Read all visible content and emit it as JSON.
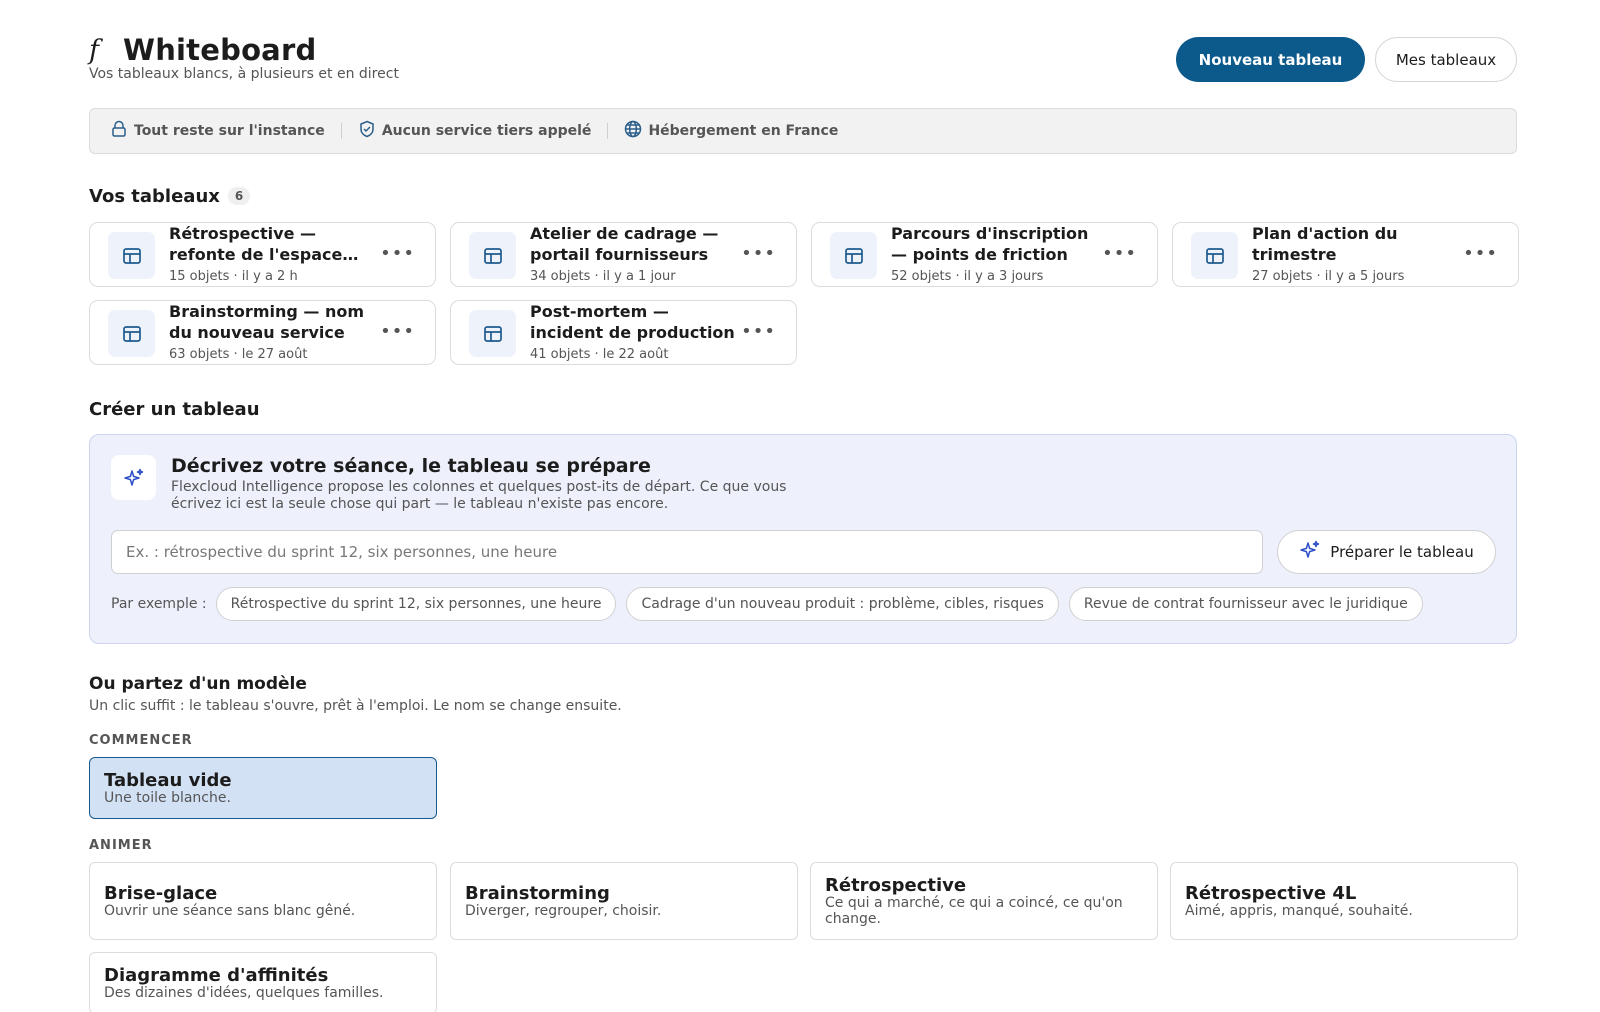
{
  "header": {
    "logo_mark": "𝑓",
    "title": "Whiteboard",
    "subtitle": "Vos tableaux blancs, à plusieurs et en direct",
    "new_board_label": "Nouveau tableau",
    "my_boards_label": "Mes tableaux"
  },
  "trust_bar": {
    "items": [
      {
        "label": "Tout reste sur l'instance",
        "icon": "lock-icon"
      },
      {
        "label": "Aucun service tiers appelé",
        "icon": "shield-check-icon"
      },
      {
        "label": "Hébergement en France",
        "icon": "globe-icon"
      }
    ]
  },
  "boards": {
    "title": "Vos tableaux",
    "count": "6",
    "items": [
      {
        "title": "Rétrospective — refonte de l'espace client",
        "meta": "15 objets · il y a 2 h"
      },
      {
        "title": "Atelier de cadrage — portail fournisseurs",
        "meta": "34 objets · il y a 1 jour"
      },
      {
        "title": "Parcours d'inscription — points de friction",
        "meta": "52 objets · il y a 3 jours"
      },
      {
        "title": "Plan d'action du trimestre",
        "meta": "27 objets · il y a 5 jours"
      },
      {
        "title": "Brainstorming — nom du nouveau service",
        "meta": "63 objets · le 27 août"
      },
      {
        "title": "Post-mortem — incident de production",
        "meta": "41 objets · le 22 août"
      }
    ]
  },
  "create": {
    "title": "Créer un tableau",
    "ai_title": "Décrivez votre séance, le tableau se prépare",
    "ai_desc": "Flexcloud Intelligence propose les colonnes et quelques post-its de départ. Ce que vous écrivez ici est la seule chose qui part — le tableau n'existe pas encore.",
    "input_placeholder": "Ex. : rétrospective du sprint 12, six personnes, une heure",
    "prepare_label": "Préparer le tableau",
    "examples_label": "Par exemple :",
    "examples": [
      "Rétrospective du sprint 12, six personnes, une heure",
      "Cadrage d'un nouveau produit : problème, cibles, risques",
      "Revue de contrat fournisseur avec le juridique"
    ]
  },
  "templates": {
    "title": "Ou partez d'un modèle",
    "subtitle": "Un clic suffit : le tableau s'ouvre, prêt à l'emploi. Le nom se change ensuite.",
    "start_label": "COMMENCER",
    "blank": {
      "name": "Tableau vide",
      "desc": "Une toile blanche."
    },
    "animate_label": "ANIMER",
    "animate": [
      {
        "name": "Brise-glace",
        "desc": "Ouvrir une séance sans blanc gêné."
      },
      {
        "name": "Brainstorming",
        "desc": "Diverger, regrouper, choisir."
      },
      {
        "name": "Rétrospective",
        "desc": "Ce qui a marché, ce qui a coincé, ce qu'on change."
      },
      {
        "name": "Rétrospective 4L",
        "desc": "Aimé, appris, manqué, souhaité."
      },
      {
        "name": "Diagramme d'affinités",
        "desc": "Des dizaines d'idées, quelques familles."
      }
    ]
  },
  "colors": {
    "primary": "#0c5a8c",
    "ai_panel_bg": "#eef1fc",
    "selected_bg": "#d3e1f5",
    "sparkle": "#2f4fc9"
  }
}
